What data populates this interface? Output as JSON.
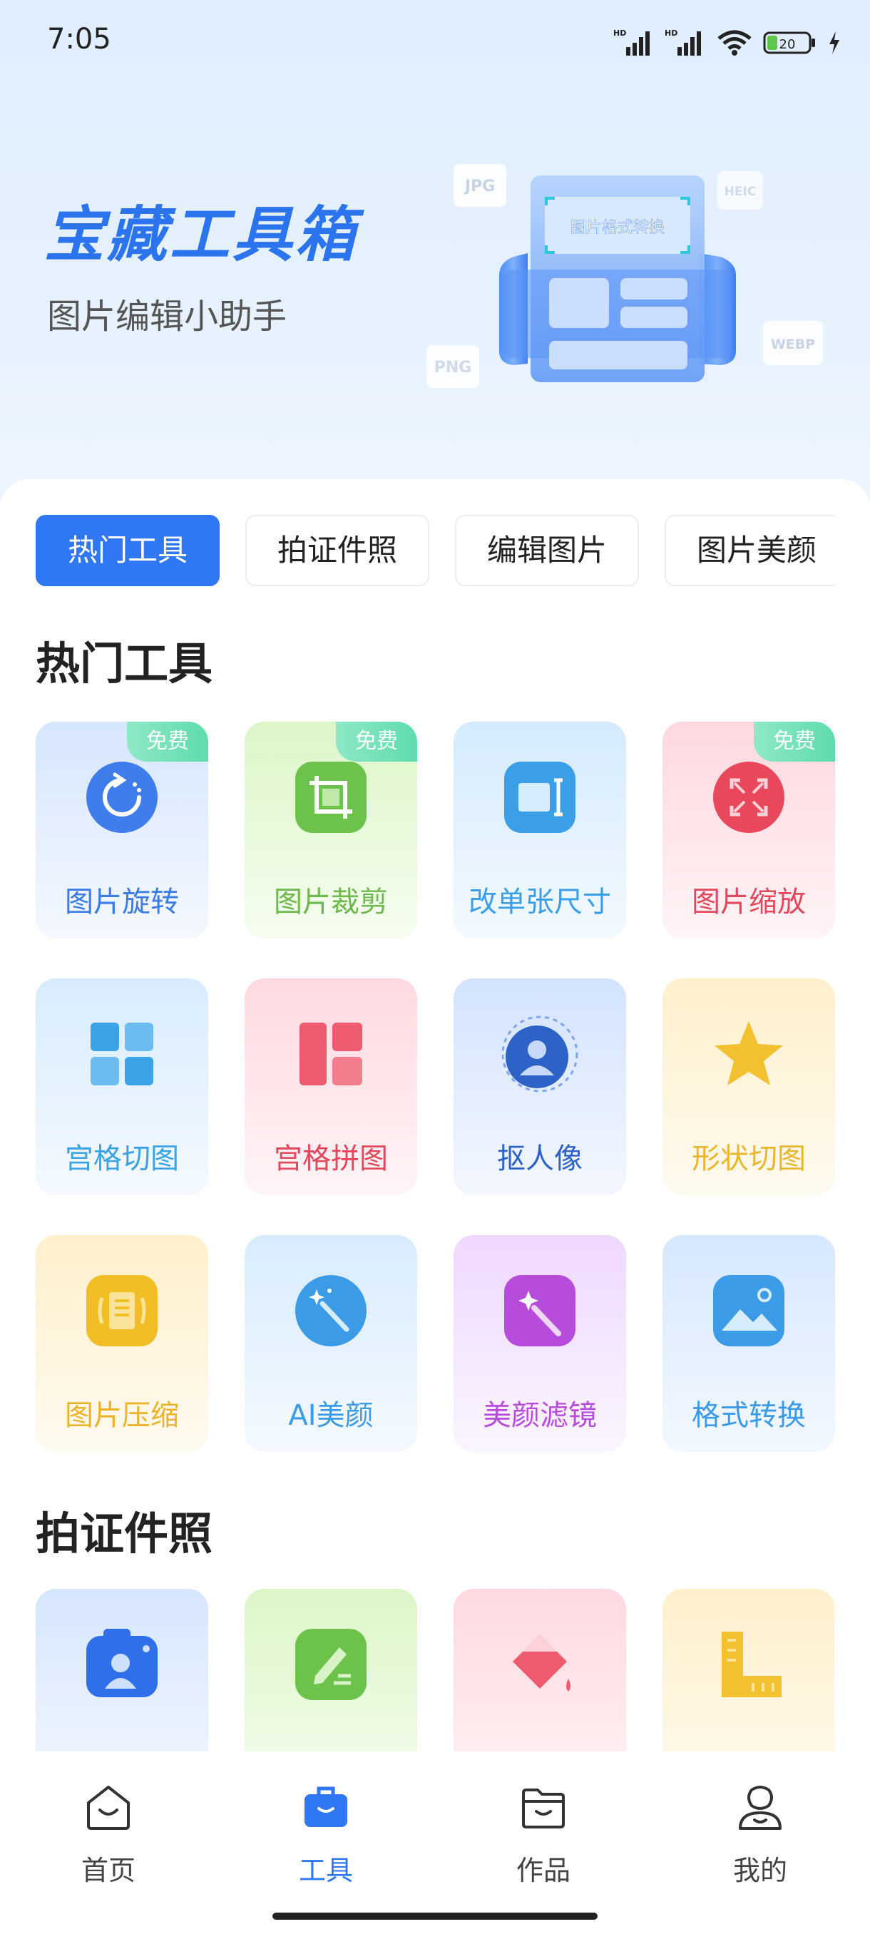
{
  "status_bar": {
    "time": "7:05",
    "signal_1_label": "HD",
    "signal_2_label": "HD",
    "battery": "20"
  },
  "hero": {
    "title": "宝藏工具箱",
    "subtitle": "图片编辑小助手",
    "illustration": {
      "card_text": "图片格式转换",
      "tag_jpg": "JPG",
      "tag_heic": "HEIC",
      "tag_png": "PNG",
      "tag_webp": "WEBP"
    }
  },
  "tabs": [
    {
      "label": "热门工具",
      "active": true
    },
    {
      "label": "拍证件照",
      "active": false
    },
    {
      "label": "编辑图片",
      "active": false
    },
    {
      "label": "图片美颜",
      "active": false
    }
  ],
  "sections": {
    "hot_tools": {
      "title": "热门工具",
      "items": [
        {
          "label": "图片旋转",
          "badge": "免费",
          "icon": "rotate-icon",
          "color": "#3a7be6"
        },
        {
          "label": "图片裁剪",
          "badge": "免费",
          "icon": "crop-icon",
          "color": "#6cc24a"
        },
        {
          "label": "改单张尺寸",
          "badge": "",
          "icon": "resize-icon",
          "color": "#3b9fe8"
        },
        {
          "label": "图片缩放",
          "badge": "免费",
          "icon": "zoom-icon",
          "color": "#e2475c"
        },
        {
          "label": "宫格切图",
          "badge": "",
          "icon": "grid-cut-icon",
          "color": "#39a3e4"
        },
        {
          "label": "宫格拼图",
          "badge": "",
          "icon": "grid-collage-icon",
          "color": "#e2475c"
        },
        {
          "label": "抠人像",
          "badge": "",
          "icon": "portrait-cutout-icon",
          "color": "#2d62c7"
        },
        {
          "label": "形状切图",
          "badge": "",
          "icon": "star-icon",
          "color": "#e8b72e"
        },
        {
          "label": "图片压缩",
          "badge": "",
          "icon": "compress-icon",
          "color": "#ebb32a"
        },
        {
          "label": "AI美颜",
          "badge": "",
          "icon": "magic-wand-icon",
          "color": "#3c9be6"
        },
        {
          "label": "美颜滤镜",
          "badge": "",
          "icon": "filter-wand-icon",
          "color": "#b64bdc"
        },
        {
          "label": "格式转换",
          "badge": "",
          "icon": "image-icon",
          "color": "#3c9be6"
        }
      ]
    },
    "id_photo": {
      "title": "拍证件照",
      "items": [
        {
          "icon": "id-camera-icon"
        },
        {
          "icon": "edit-document-icon"
        },
        {
          "icon": "paint-bucket-icon"
        },
        {
          "icon": "ruler-icon"
        }
      ]
    }
  },
  "bottom_nav": [
    {
      "label": "首页",
      "icon": "home-icon",
      "active": false
    },
    {
      "label": "工具",
      "icon": "toolbox-icon",
      "active": true
    },
    {
      "label": "作品",
      "icon": "folder-icon",
      "active": false
    },
    {
      "label": "我的",
      "icon": "profile-icon",
      "active": false
    }
  ],
  "colors": {
    "accent": "#2f77f5",
    "hero_title": "#2c74ee",
    "badge": "#5fdcae"
  }
}
